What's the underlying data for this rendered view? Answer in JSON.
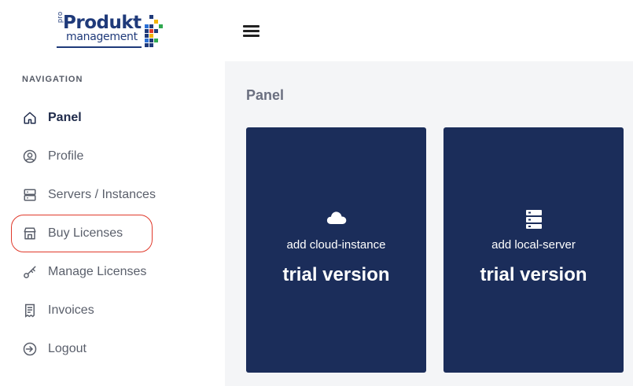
{
  "logo": {
    "pro": "pro",
    "word1": "Produkt",
    "word2": "management"
  },
  "colors": {
    "sidebar_bg": "#ffffff",
    "card_bg": "#1b2d5a",
    "highlight": "#e0392b",
    "brand": "#1f3a7a"
  },
  "sidebar": {
    "heading": "NAVIGATION",
    "items": [
      {
        "label": "Panel",
        "icon": "home-icon",
        "active": true
      },
      {
        "label": "Profile",
        "icon": "user-circle-icon"
      },
      {
        "label": "Servers / Instances",
        "icon": "server-icon"
      },
      {
        "label": "Buy Licenses",
        "icon": "store-icon"
      },
      {
        "label": "Manage Licenses",
        "icon": "key-icon"
      },
      {
        "label": "Invoices",
        "icon": "invoice-icon"
      },
      {
        "label": "Logout",
        "icon": "logout-icon"
      }
    ]
  },
  "topbar": {
    "menu_icon": "hamburger-icon"
  },
  "main": {
    "title": "Panel",
    "cards": [
      {
        "icon": "cloud-icon",
        "subtitle": "add cloud-instance",
        "title": "trial version"
      },
      {
        "icon": "server-stack-icon",
        "subtitle": "add local-server",
        "title": "trial version"
      }
    ]
  }
}
